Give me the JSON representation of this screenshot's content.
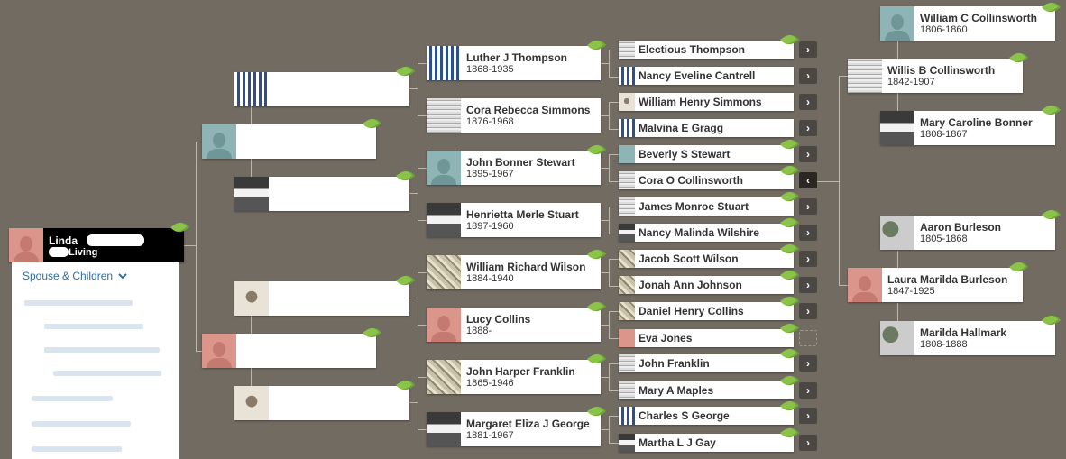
{
  "root": {
    "name": "Linda",
    "status": "Living"
  },
  "spouse_children": {
    "label": "Spouse & Children",
    "chevron": "chevron-down-icon"
  },
  "gen4_left": [
    {
      "name": "Luther J Thompson",
      "dates": "1868-1935"
    },
    {
      "name": "Cora Rebecca Simmons",
      "dates": "1876-1968"
    },
    {
      "name": "John Bonner Stewart",
      "dates": "1895-1967"
    },
    {
      "name": "Henrietta Merle Stuart",
      "dates": "1897-1960"
    },
    {
      "name": "William Richard Wilson",
      "dates": "1884-1940"
    },
    {
      "name": "Lucy Collins",
      "dates": "1888-"
    },
    {
      "name": "John Harper Franklin",
      "dates": "1865-1946"
    },
    {
      "name": "Margaret Eliza J George",
      "dates": "1881-1967"
    }
  ],
  "gen5": [
    {
      "name": "Electious Thompson"
    },
    {
      "name": "Nancy Eveline Cantrell"
    },
    {
      "name": "William Henry Simmons"
    },
    {
      "name": "Malvina E Gragg"
    },
    {
      "name": "Beverly S Stewart"
    },
    {
      "name": "Cora O Collinsworth"
    },
    {
      "name": "James Monroe Stuart"
    },
    {
      "name": "Nancy Malinda Wilshire"
    },
    {
      "name": "Jacob Scott Wilson"
    },
    {
      "name": "Jonah Ann Johnson"
    },
    {
      "name": "Daniel Henry Collins"
    },
    {
      "name": "Eva Jones"
    },
    {
      "name": "John Franklin"
    },
    {
      "name": "Mary A Maples"
    },
    {
      "name": "Charles S George"
    },
    {
      "name": "Martha L J Gay"
    }
  ],
  "right_mid": [
    {
      "name": "Willis B Collinsworth",
      "dates": "1842-1907"
    },
    {
      "name": "Laura Marilda Burleson",
      "dates": "1847-1925"
    }
  ],
  "right_far": [
    {
      "name": "William C Collinsworth",
      "dates": "1806-1860"
    },
    {
      "name": "Mary Caroline Bonner",
      "dates": "1808-1867"
    },
    {
      "name": "Aaron Burleson",
      "dates": "1805-1868"
    },
    {
      "name": "Marilda Hallmark",
      "dates": "1808-1888"
    }
  ],
  "icons": {
    "expand": "›",
    "collapse": "‹",
    "hint": "hint-leaf-icon"
  },
  "colors": {
    "background": "#716b62",
    "leaf": "#8bc34a",
    "male": "#8fb4b5",
    "female": "#dc958b",
    "link": "#2f6f9f"
  }
}
